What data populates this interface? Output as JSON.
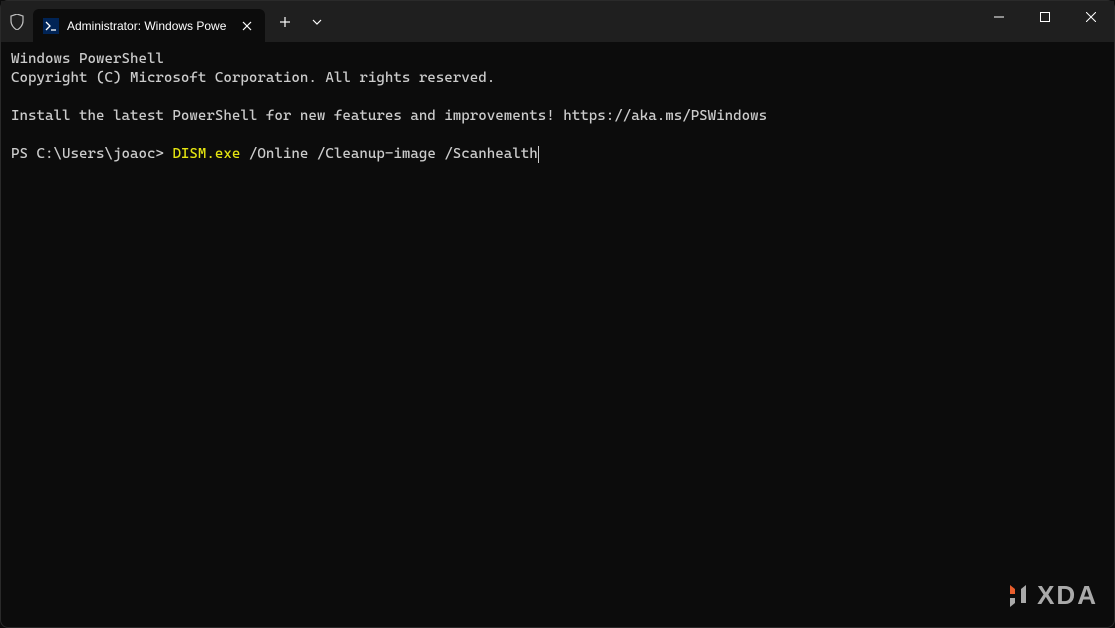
{
  "tab": {
    "title": "Administrator: Windows Powe"
  },
  "terminal": {
    "line1": "Windows PowerShell",
    "line2": "Copyright (C) Microsoft Corporation. All rights reserved.",
    "line3": "Install the latest PowerShell for new features and improvements! https://aka.ms/PSWindows",
    "prompt": "PS C:\\Users\\joaoc> ",
    "command_exe": "DISM.exe",
    "command_args": " /Online /Cleanup-image /Scanhealth"
  },
  "watermark": {
    "text": "XDA"
  }
}
